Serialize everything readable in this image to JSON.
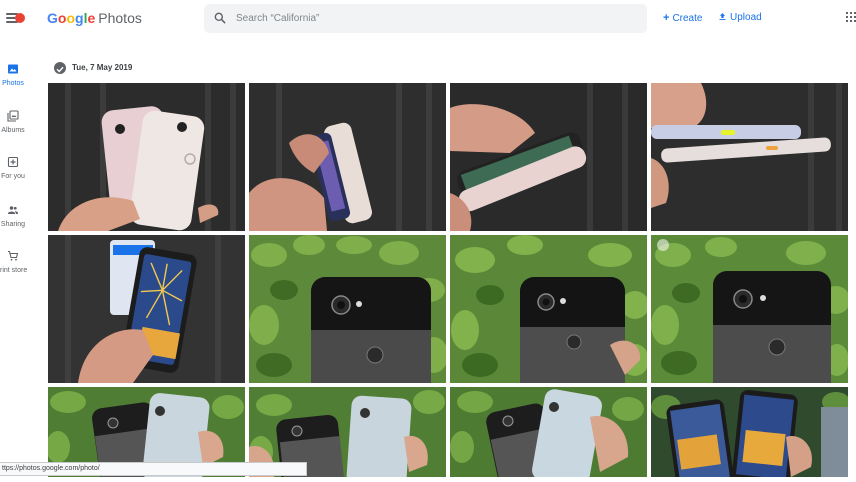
{
  "header": {
    "logo_google": "Google",
    "logo_photos": "Photos",
    "search_placeholder": "Search “California”",
    "create_label": "Create",
    "upload_label": "Upload"
  },
  "sidebar": {
    "items": [
      {
        "label": "Photos",
        "icon": "photo-icon",
        "active": true
      },
      {
        "label": "Albums",
        "icon": "album-icon",
        "active": false
      },
      {
        "label": "For you",
        "icon": "add-box-icon",
        "active": false
      },
      {
        "label": "Sharing",
        "icon": "people-icon",
        "active": false
      },
      {
        "label": "rint store",
        "icon": "cart-icon",
        "active": false
      }
    ]
  },
  "main": {
    "date_label": "Tue, 7 May 2019"
  },
  "status_bar": {
    "url": "ttps://photos.google.com/photo/"
  },
  "colors": {
    "accent": "#1a73e8",
    "red": "#ea4335",
    "search_bg": "#f1f3f4",
    "sidebar_text": "#5f6368"
  }
}
